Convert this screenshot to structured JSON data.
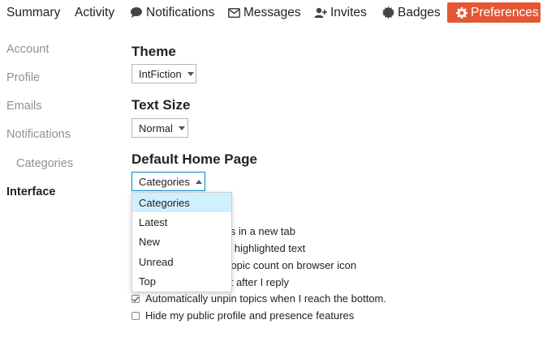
{
  "nav": {
    "summary": "Summary",
    "activity": "Activity",
    "notifications": "Notifications",
    "messages": "Messages",
    "invites": "Invites",
    "badges": "Badges",
    "preferences": "Preferences",
    "accent_color": "#e45735"
  },
  "sidebar": {
    "items": [
      "Account",
      "Profile",
      "Emails",
      "Notifications",
      "Categories",
      "Interface"
    ],
    "active": "Interface"
  },
  "theme": {
    "title": "Theme",
    "value": "IntFiction"
  },
  "text_size": {
    "title": "Text Size",
    "value": "Normal"
  },
  "home_page": {
    "title": "Default Home Page",
    "value": "Categories",
    "options": [
      "Categories",
      "Latest",
      "New",
      "Unread",
      "Top"
    ]
  },
  "checkboxes": [
    {
      "label": "nks in a new tab",
      "checked": false
    },
    {
      "label": "for highlighted text",
      "checked": false
    },
    {
      "label": "d topic count on browser icon",
      "checked": false
    },
    {
      "label": "ost after I reply",
      "checked": false
    },
    {
      "label": "Automatically unpin topics when I reach the bottom.",
      "checked": true
    },
    {
      "label": "Hide my public profile and presence features",
      "checked": false
    }
  ]
}
